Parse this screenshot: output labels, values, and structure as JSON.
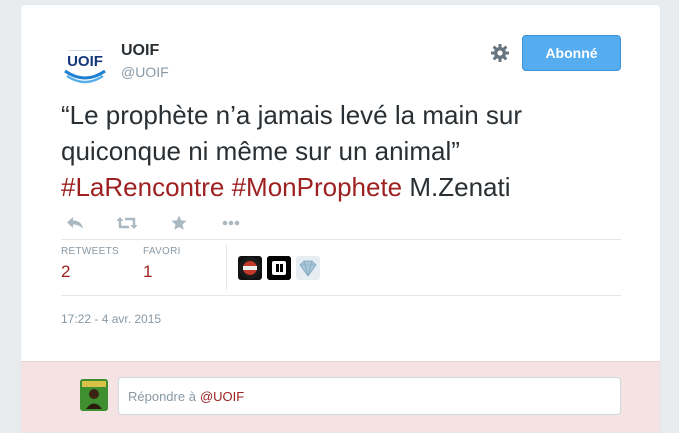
{
  "tweet": {
    "account": {
      "display_name": "UOIF",
      "handle": "@UOIF",
      "logo_text": "UOIF",
      "avatar_icon": "uoif-logo"
    },
    "follow_button_label": "Abonné",
    "settings_icon": "gear-icon",
    "text": {
      "quote": "“Le prophète n’a jamais levé la main sur quiconque ni même sur un animal”",
      "hashtag_1": "#LaRencontre",
      "hashtag_2": "#MonProphete",
      "author": "M.Zenati"
    },
    "actions": [
      {
        "name": "reply",
        "icon": "reply-icon"
      },
      {
        "name": "retweet",
        "icon": "retweet-icon"
      },
      {
        "name": "favorite",
        "icon": "star-icon"
      },
      {
        "name": "more",
        "icon": "more-icon"
      }
    ],
    "stats": {
      "retweets_label": "RETWEETS",
      "retweets_count": "2",
      "favorites_label": "FAVORI",
      "favorites_count": "1"
    },
    "timestamp": "17:22 - 4 avr. 2015"
  },
  "reply": {
    "prefix": "Répondre à",
    "mention": "@UOIF"
  },
  "colors": {
    "link": "#9e2121",
    "follow_button": "#55acee",
    "reply_bg": "#f5e3e3"
  }
}
